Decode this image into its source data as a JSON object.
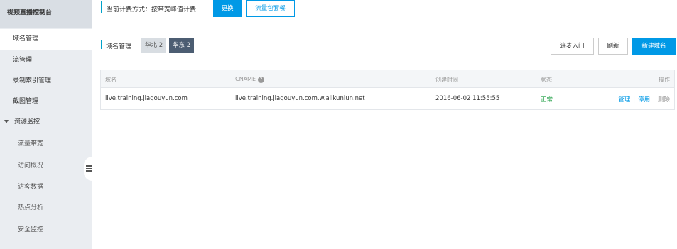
{
  "sidebar": {
    "title": "视频直播控制台",
    "items": [
      {
        "label": "域名管理"
      },
      {
        "label": "流管理"
      },
      {
        "label": "录制索引管理"
      },
      {
        "label": "截图管理"
      },
      {
        "label": "资源监控"
      },
      {
        "label": "流量带宽"
      },
      {
        "label": "访问概况"
      },
      {
        "label": "访客数据"
      },
      {
        "label": "热点分析"
      },
      {
        "label": "安全监控"
      }
    ]
  },
  "billing": {
    "label": "当前计费方式：按带宽峰值计费",
    "change_label": "更换",
    "package_label": "流量包套餐"
  },
  "domain_section": {
    "title": "域名管理",
    "regions": [
      "华北 2",
      "华东 2"
    ],
    "selected_region": "华东 2",
    "lianmai_label": "连麦入门",
    "refresh_label": "刷新",
    "new_domain_label": "新建域名"
  },
  "table": {
    "columns": [
      "域名",
      "CNAME",
      "创建时间",
      "状态",
      "操作"
    ],
    "rows": [
      {
        "domain": "live.training.jiagouyun.com",
        "cname": "live.training.jiagouyun.com.w.alikunlun.net",
        "created": "2016-06-02 11:55:55",
        "status": "正常",
        "actions": [
          "管理",
          "停用",
          "删除"
        ]
      }
    ]
  },
  "colors": {
    "accent": "#0099e6",
    "sidebar_bg": "#eaedf1",
    "status_ok": "#1e9e43",
    "region_active": "#4c5d72"
  }
}
